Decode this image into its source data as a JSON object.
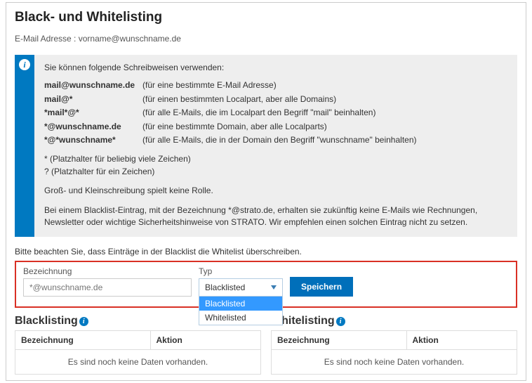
{
  "title": "Black- und Whitelisting",
  "email": {
    "label": "E-Mail Adresse :",
    "value": "vorname@wunschname.de"
  },
  "info": {
    "lead": "Sie können folgende Schreibweisen verwenden:",
    "patterns": [
      {
        "pattern": "mail@wunschname.de",
        "desc": "(für eine bestimmte E-Mail Adresse)"
      },
      {
        "pattern": "mail@*",
        "desc": "(für einen bestimmten Localpart, aber alle Domains)"
      },
      {
        "pattern": "*mail*@*",
        "desc": "(für alle E-Mails, die im Localpart den Begriff \"mail\" beinhalten)"
      },
      {
        "pattern": "*@wunschname.de",
        "desc": "(für eine bestimmte Domain, aber alle Localparts)"
      },
      {
        "pattern": "*@*wunschname*",
        "desc": "(für alle E-Mails, die in der Domain den Begriff \"wunschname\" beinhalten)"
      }
    ],
    "note1": "* (Platzhalter für beliebig viele Zeichen)",
    "note2": "? (Platzhalter für ein Zeichen)",
    "para1": "Groß- und Kleinschreibung spielt keine Rolle.",
    "para2": "Bei einem Blacklist-Eintrag, mit der Bezeichnung *@strato.de, erhalten sie zukünftig keine E-Mails wie Rechnungen, Newsletter oder wichtige Sicherheitshinweise von STRATO. Wir empfehlen einen solchen Eintrag nicht zu setzen."
  },
  "overwrite_note": "Bitte beachten Sie, dass Einträge in der Blacklist die Whitelist überschreiben.",
  "form": {
    "bezeichnung_label": "Bezeichnung",
    "bezeichnung_placeholder": "*@wunschname.de",
    "typ_label": "Typ",
    "typ_value": "Blacklisted",
    "options": [
      "Blacklisted",
      "Whitelisted"
    ],
    "submit_label": "Speichern"
  },
  "tables": {
    "blacklisting": {
      "title": "Blacklisting",
      "col1": "Bezeichnung",
      "col2": "Aktion",
      "empty": "Es sind noch keine Daten vorhanden."
    },
    "whitelisting": {
      "title": "Whitelisting",
      "col1": "Bezeichnung",
      "col2": "Aktion",
      "empty": "Es sind noch keine Daten vorhanden."
    }
  }
}
